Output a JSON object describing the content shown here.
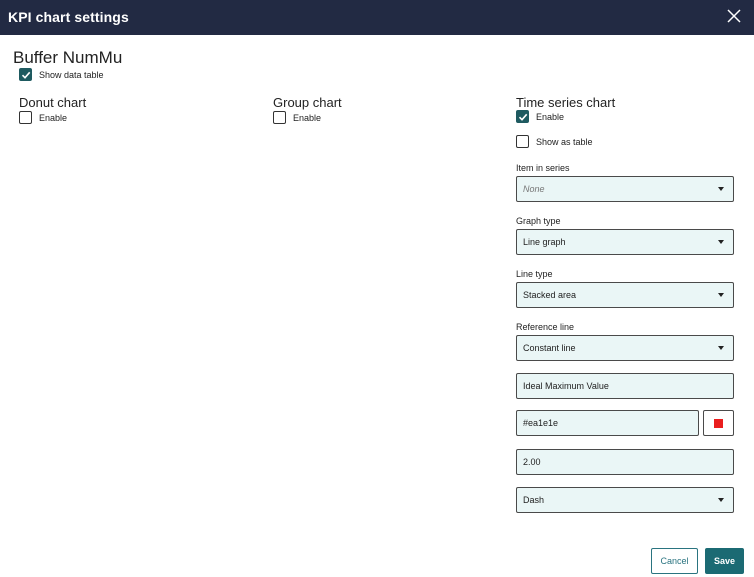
{
  "dialog": {
    "title": "KPI chart settings",
    "kpi_name": "Buffer NumMu",
    "show_data_table": {
      "label": "Show data table",
      "checked": true
    }
  },
  "donut": {
    "title": "Donut chart",
    "enable": {
      "label": "Enable",
      "checked": false
    }
  },
  "group": {
    "title": "Group chart",
    "enable": {
      "label": "Enable",
      "checked": false
    }
  },
  "timeseries": {
    "title": "Time series chart",
    "enable": {
      "label": "Enable",
      "checked": true
    },
    "show_as_table": {
      "label": "Show as table",
      "checked": false
    },
    "item_in_series": {
      "label": "Item in series",
      "value": "None"
    },
    "graph_type": {
      "label": "Graph type",
      "value": "Line graph"
    },
    "line_type": {
      "label": "Line type",
      "value": "Stacked area"
    },
    "reference_line": {
      "label": "Reference line",
      "value": "Constant line",
      "name_value": "Ideal Maximum Value",
      "color_value": "#ea1e1e",
      "thickness_value": "2.00",
      "style_value": "Dash"
    }
  },
  "footer": {
    "cancel_label": "Cancel",
    "save_label": "Save"
  },
  "colors": {
    "titlebar": "#222a43",
    "accent": "#1b6a73",
    "field_bg": "#eaf6f6",
    "swatch": "#ea1e1e"
  }
}
